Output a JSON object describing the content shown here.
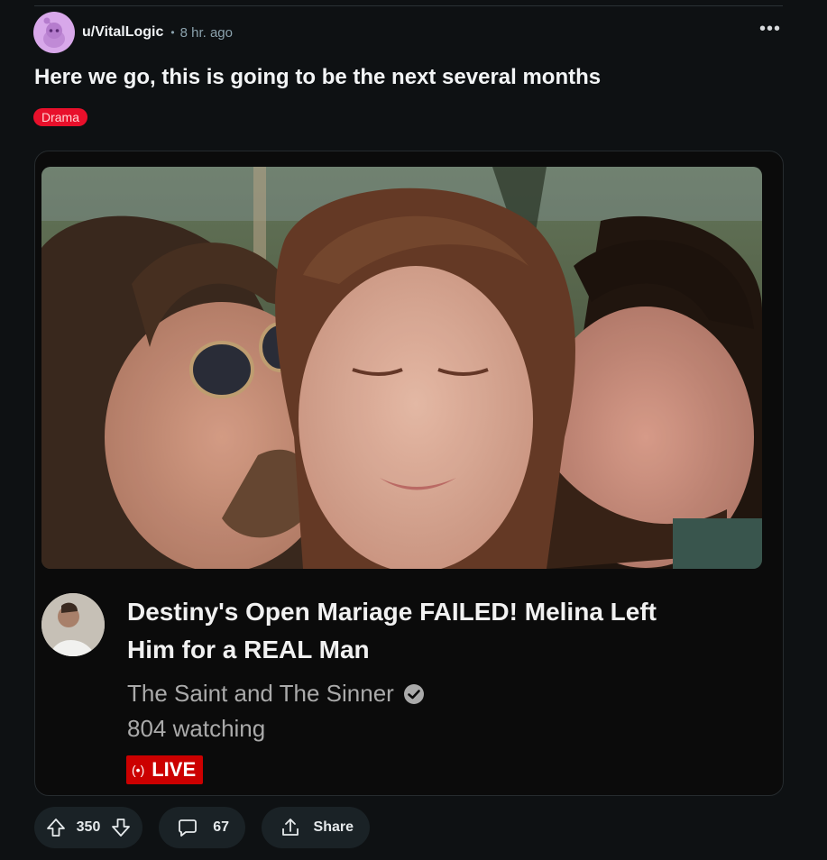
{
  "post": {
    "username": "u/VitalLogic",
    "separator": "•",
    "time": "8 hr. ago",
    "more_icon": "more-horizontal-icon",
    "title": "Here we go, this is going to be the next several months",
    "flair": "Drama",
    "flair_color": "#e8102b"
  },
  "video": {
    "title": "Destiny's Open Mariage FAILED! Melina Left Him for a REAL Man",
    "channel": "The Saint and The Sinner",
    "verified_icon": "verified-check-icon",
    "watching": "804 watching",
    "live_icon": "(•)",
    "live_label": "LIVE",
    "live_color": "#cc0000"
  },
  "actions": {
    "upvote_icon": "arrow-up-icon",
    "score": "350",
    "downvote_icon": "arrow-down-icon",
    "comment_icon": "comment-bubble-icon",
    "comments": "67",
    "share_icon": "share-icon",
    "share_label": "Share"
  }
}
